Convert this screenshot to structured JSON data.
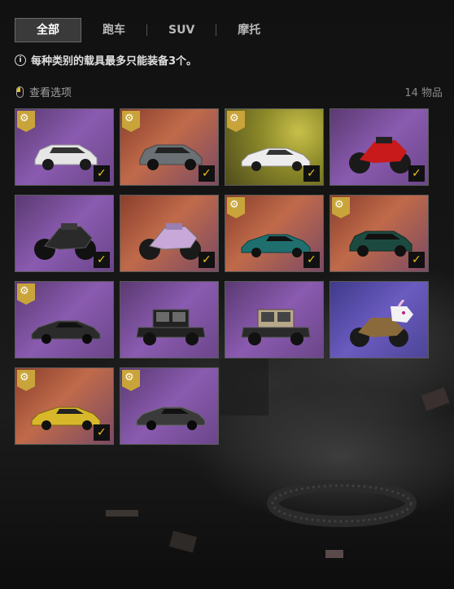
{
  "tabs": [
    {
      "label": "全部",
      "active": true
    },
    {
      "label": "跑车",
      "active": false
    },
    {
      "label": "SUV",
      "active": false
    },
    {
      "label": "摩托",
      "active": false
    }
  ],
  "notice": {
    "icon": "info-icon",
    "text": "每种类别的载具最多只能装备3个。"
  },
  "options": {
    "icon": "mouse-icon",
    "label": "查看选项"
  },
  "count_label": "14 物品",
  "colors": {
    "badge": "#c9a43a",
    "check": "#f0c21a",
    "active_tab_bg": "#3a3a3a"
  },
  "items": [
    {
      "vehicle": "white-suv",
      "body_color": "#e6e6e6",
      "background": "purple",
      "badge": true,
      "equipped": true
    },
    {
      "vehicle": "gray-suv",
      "body_color": "#6a7073",
      "background": "orange",
      "badge": true,
      "equipped": true
    },
    {
      "vehicle": "white-sports-car",
      "body_color": "#ececec",
      "background": "gold",
      "badge": true,
      "equipped": true
    },
    {
      "vehicle": "red-motorcycle",
      "body_color": "#c81a1a",
      "background": "purple",
      "badge": false,
      "equipped": true
    },
    {
      "vehicle": "black-motorcycle",
      "body_color": "#2a2a2a",
      "background": "purple",
      "badge": false,
      "equipped": true
    },
    {
      "vehicle": "anime-motorcycle",
      "body_color": "#c8a8d8",
      "background": "orange",
      "badge": false,
      "equipped": true
    },
    {
      "vehicle": "teal-sports-car",
      "body_color": "#1f6f6f",
      "background": "orange",
      "badge": true,
      "equipped": true
    },
    {
      "vehicle": "green-suv",
      "body_color": "#1d4a40",
      "background": "orange",
      "badge": true,
      "equipped": true
    },
    {
      "vehicle": "black-sports-car",
      "body_color": "#2b2b2b",
      "background": "purple",
      "badge": true,
      "equipped": false
    },
    {
      "vehicle": "black-classic-car",
      "body_color": "#222222",
      "background": "purple",
      "badge": false,
      "equipped": false
    },
    {
      "vehicle": "beige-classic-car",
      "body_color": "#b8a88a",
      "background": "purple",
      "badge": false,
      "equipped": false
    },
    {
      "vehicle": "unicorn-motorcycle",
      "body_color": "#8a6a3a",
      "background": "violet",
      "badge": false,
      "equipped": false
    },
    {
      "vehicle": "yellow-sports-car",
      "body_color": "#d8b82a",
      "background": "orange",
      "badge": true,
      "equipped": true
    },
    {
      "vehicle": "carbon-sports-car",
      "body_color": "#3a3a3a",
      "background": "purple",
      "badge": true,
      "equipped": false
    }
  ]
}
